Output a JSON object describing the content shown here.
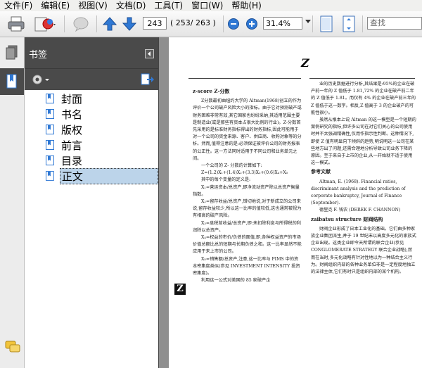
{
  "menu": [
    "文件(F)",
    "编辑(E)",
    "视图(V)",
    "文档(D)",
    "工具(T)",
    "窗口(W)",
    "帮助(H)"
  ],
  "toolbar": {
    "current_page": "243",
    "page_count": "( 253/ 263 )",
    "zoom": "31.4%",
    "search_placeholder": "查找"
  },
  "sidebar": {
    "title": "书签",
    "bookmarks": [
      "封面",
      "书名",
      "版权",
      "前言",
      "目录",
      "正文"
    ],
    "selected_index": 5
  },
  "document": {
    "page_letter": "Z",
    "side_marker": "Z",
    "left_col": [
      {
        "h": "z-score  Z-分数"
      },
      {
        "p": "Z分数最初由纽约大学的 Altman(1968)创立的作为评价一个公司破产风险大小的指标。由于它对预测破产或财务困难非常有效,其它国家也纷纷采纳,其适用范围主要是制造业(或是那些有资本占很大比例的行业)。Z-分数首先采用的是标准财务指标得出的财务指标,因此可能用于对一个公司的资金来源、客户、供应商、收购对象等的分析。然而,值得注意的是:必须保证被评价公司的财务报表的公正性。这一方法同时适用于不同公司和业务单元之间。"
      },
      {
        "p": "一个公司的 Z- 分数的计算如下:"
      },
      {
        "p": "Z=(1.2)X₁+(1.4)X₂+(3.3)X₃+(0.6)X₄+X₅"
      },
      {
        "p": "其中的每个变量的定义是:"
      },
      {
        "p": "X₁=营运资本/总资产,即净流动资产除以总资产衡量指数。"
      },
      {
        "p": "X₂=留存收益/总资产,错切地说,对于新成立的公司来说,留存收益较少,所以这一比率的值较低,这也通常被视为有相高的破产风险。"
      },
      {
        "p": "X₃=息税前收益/总资产,即:未扣除利息与所得税的利润除以总资产。"
      },
      {
        "p": "X₄=权益的市价/负债的面值,即,各种权益资产的市场价值总额比总的短期与长期负债之和。这一比率显然不能应用于未上市的公司。"
      },
      {
        "p": "X₅=销售额/总资产,注意,这一比率与 PIMS 中的资本密集度类似(参见 INVESTMENT INTENSITY 投资密集度)。"
      },
      {
        "p": "利用这一公式对美国的 85 家破产企"
      }
    ],
    "right_col": [
      {
        "p": "业的历史数据进行分析,其结果是:95%的企业在破产前一年的 Z 值低于 1.81,72% 的企业在破产前二年的 Z 值低于 1.81。而仅有 4% 的企业在破产前三年的 Z 值低于这一数字。相反,Z 值高于 3 的企业破产的可能性很小。"
      },
      {
        "p": "虽然从根本上说 Altman 的这一模型是一个短期的案例研究的指标,但许多公司在对它们关心的公司使用时并不太强调精确性,仅用作指示性判断。这种情况下,即使 Z 值有明显向下倾斜的趋势,明说明这一公司在某些地方出了问题,还需合理地分析导致公司业务下降的原因。至于来自于上市的企业,从一开始就不适于使用这一模式。"
      },
      {
        "h": "参考文献"
      },
      {
        "p": "Altman, E. (1968). Financial ratios, discriminant analysis and the prediction of corporate bankruptcy, Journal of Finance (September)."
      },
      {
        "p": "德里克 F. 钱农 (DEREK F. CHANNON)"
      },
      {
        "h": "zaibatsu structure 财阀结构"
      },
      {
        "p": "财阀企业形成了日本工业化的基础。它们由多种家族企业集团派生,并于 19 世纪末以高度多元化的家族式企业出现。这类企业即今天所谓的联合企业(参见 CONGLOMERATE STRATEGY 联合企业战略),然而在当时,多元化战略有针对性地以为一种结合主义行为。财阀组织内部的各种业务单位非是一定程度地独立的法律主体,它们有时只是组织内部的某个机构。"
      }
    ]
  }
}
